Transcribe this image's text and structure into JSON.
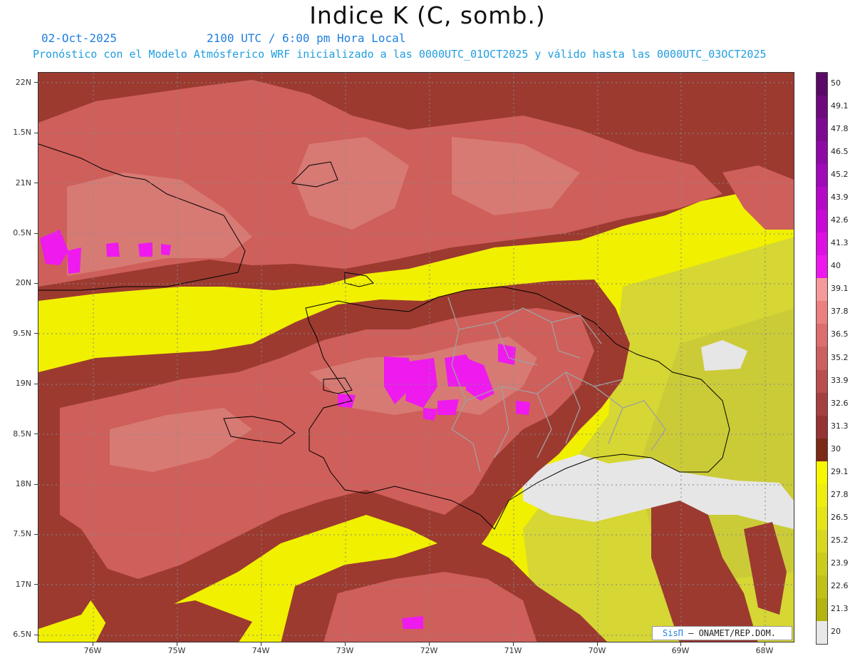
{
  "title": "Indice K (C, somb.)",
  "date": "02-Oct-2025",
  "time": "2100 UTC / 6:00 pm Hora Local",
  "subtitle": "Pronóstico con el Modelo Atmósferico WRF inicializado a las 0000UTC_01OCT2025 y válido hasta las  0000UTC_03OCT2025",
  "credit": {
    "logo": "SisΠ",
    "text": " – ONAMET/REP.DOM."
  },
  "lat_labels": [
    "22N",
    "1.5N",
    "21N",
    "0.5N",
    "20N",
    "9.5N",
    "19N",
    "8.5N",
    "18N",
    "7.5N",
    "17N",
    "6.5N"
  ],
  "lon_labels": [
    "76W",
    "75W",
    "74W",
    "73W",
    "72W",
    "71W",
    "70W",
    "69W",
    "68W"
  ],
  "colorbar": {
    "labels": [
      "50",
      "49.1",
      "47.8",
      "46.5",
      "45.2",
      "43.9",
      "42.6",
      "41.3",
      "40",
      "39.1",
      "37.8",
      "36.5",
      "35.2",
      "33.9",
      "32.6",
      "31.3",
      "30",
      "29.1",
      "27.8",
      "26.5",
      "25.2",
      "23.9",
      "22.6",
      "21.3",
      "20"
    ],
    "colors": [
      "#5a0a66",
      "#6e0a7e",
      "#7e0a92",
      "#8e0aa6",
      "#a00ab8",
      "#b40ac8",
      "#c80ad6",
      "#dc10e2",
      "#ee18ee",
      "#f49a9a",
      "#eb8080",
      "#dd6e6e",
      "#cc5f5f",
      "#b84e4e",
      "#a64040",
      "#953434",
      "#7c2a18",
      "#f6f600",
      "#eded10",
      "#e4e418",
      "#d8d820",
      "#cccc1c",
      "#c0c018",
      "#b4b410",
      "#e8e8e8"
    ]
  },
  "colors": {
    "yellow": "#f0f000",
    "lightred": "#d66a6a",
    "darkred": "#9c3a30",
    "magenta": "#ee1aee",
    "gray": "#e6e6e6",
    "olive": "#cfcf30"
  }
}
